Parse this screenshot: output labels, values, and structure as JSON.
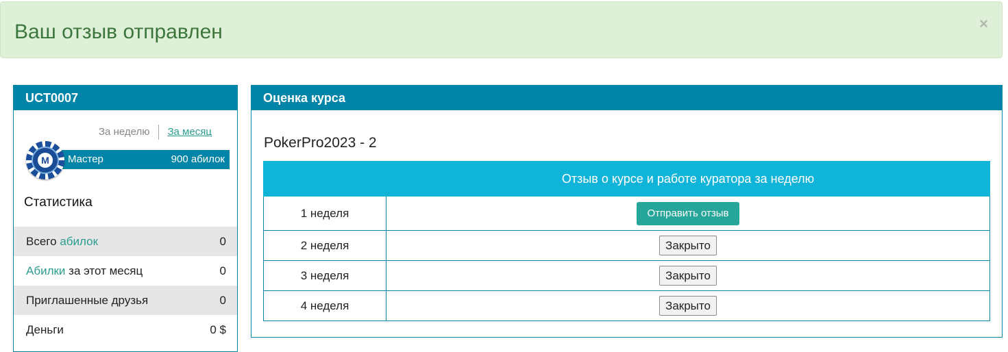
{
  "alert": {
    "message": "Ваш отзыв отправлен",
    "close_label": "×"
  },
  "profile": {
    "username": "UCT0007",
    "period_week": "За неделю",
    "period_month": "За месяц",
    "rank_icon_letter": "M",
    "rank_name": "Мастер",
    "rank_points": "900 абилок",
    "stats_title": "Статистика",
    "stats": {
      "total_prefix": "Всего ",
      "total_link": "абилок",
      "total_value": "0",
      "month_link": "Абилки",
      "month_suffix": " за этот месяц",
      "month_value": "0",
      "friends_label": "Приглашенные друзья",
      "friends_value": "0",
      "money_label": "Деньги",
      "money_value": "0 $"
    }
  },
  "course": {
    "panel_title": "Оценка курса",
    "name": "PokerPro2023 - 2",
    "table_header_col1": "",
    "table_header_col2": "Отзыв о курсе и работе куратора за неделю",
    "weeks": [
      {
        "label": "1 неделя",
        "action": "Отправить отзыв"
      },
      {
        "label": "2 неделя",
        "action": "Закрыто"
      },
      {
        "label": "3 неделя",
        "action": "Закрыто"
      },
      {
        "label": "4 неделя",
        "action": "Закрыто"
      }
    ]
  },
  "colors": {
    "alert_bg": "#dff0d8",
    "alert_text": "#3c763d",
    "panel_header": "#0085a8",
    "table_header": "#11b4d9",
    "send_button": "#26a69a",
    "link_green": "#2a9d8f"
  }
}
